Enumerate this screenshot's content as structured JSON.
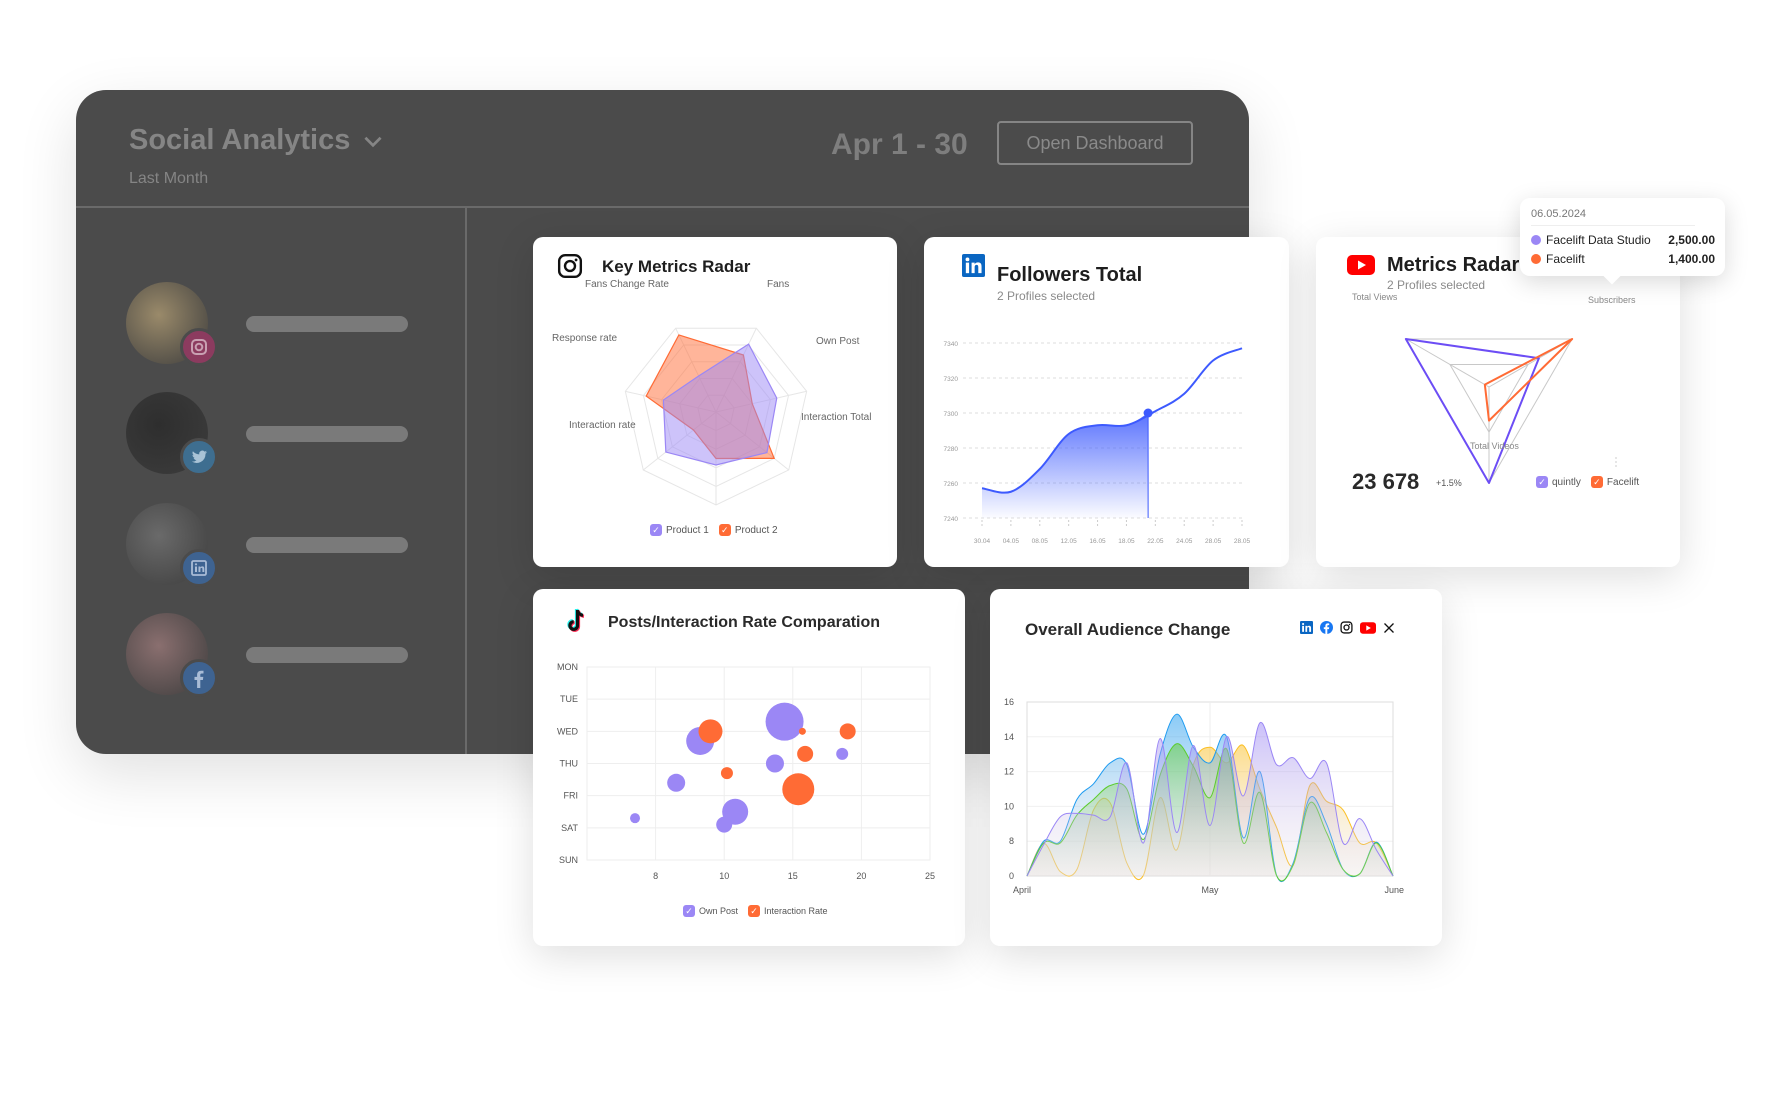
{
  "app": {
    "title": "Social Analytics",
    "subtitle": "Last Month",
    "date_range": "Apr 1 - 30",
    "open_button": "Open Dashboard"
  },
  "sidebar": {
    "profiles": [
      {
        "network": "instagram",
        "badge_icon": "instagram-icon",
        "badge_color": "#8c3b5f",
        "avatar_color": "#9a8a6a"
      },
      {
        "network": "twitter",
        "badge_icon": "twitter-icon",
        "badge_color": "#3e6e90",
        "avatar_color": "#2e2e2e"
      },
      {
        "network": "linkedin",
        "badge_icon": "linkedin-icon",
        "badge_color": "#3e6391",
        "avatar_color": "#6a6a6a"
      },
      {
        "network": "facebook",
        "badge_icon": "facebook-icon",
        "badge_color": "#3e6391",
        "avatar_color": "#8a6f6f"
      }
    ]
  },
  "cards": {
    "key_metrics": {
      "title": "Key Metrics Radar",
      "icon": "instagram-icon"
    },
    "followers": {
      "title": "Followers Total",
      "subtitle": "2 Profiles selected",
      "icon": "linkedin-icon"
    },
    "yt_radar": {
      "title": "Metrics Radar",
      "subtitle": "2 Profiles selected",
      "icon": "youtube-icon",
      "total": "23 678",
      "change": "+1.5%",
      "tooltip": {
        "date": "06.05.2024",
        "rows": [
          {
            "label": "Facelift Data Studio",
            "value": "2,500.00",
            "color": "#9b87f5"
          },
          {
            "label": "Facelift",
            "value": "1,400.00",
            "color": "#ff6b35"
          }
        ]
      }
    },
    "posts": {
      "title": "Posts/Interaction Rate Comparation",
      "icon": "tiktok-icon"
    },
    "audience": {
      "title": "Overall Audience Change",
      "network_icons": [
        "linkedin-icon",
        "facebook-icon",
        "instagram-icon",
        "youtube-icon",
        "x-icon"
      ]
    }
  },
  "colors": {
    "purple": "#9b87f5",
    "orange": "#ff6b35",
    "blue": "#3d5afe",
    "youtube": "#ff0000",
    "linkedin": "#0a66c2"
  },
  "chart_data": [
    {
      "type": "radar",
      "axes": [
        "Fans",
        "Own Post",
        "Interaction Total",
        "",
        "Interaction rate",
        "Response rate",
        "Fans Change Rate"
      ],
      "range": [
        0,
        100
      ],
      "series": [
        {
          "name": "Product 1",
          "color": "#9b87f5",
          "values": [
            81,
            67,
            70,
            57,
            69,
            58,
            43
          ]
        },
        {
          "name": "Product 2",
          "color": "#ff6b35",
          "values": [
            68,
            40,
            80,
            50,
            31,
            77,
            92
          ]
        }
      ],
      "legend": "bottom"
    },
    {
      "type": "area",
      "categories": [
        "30.04",
        "04.05",
        "08.05",
        "12.05",
        "16.05",
        "18.05",
        "22.05",
        "24.05",
        "28.05",
        "28.05"
      ],
      "values": [
        7257,
        7255,
        7268,
        7288,
        7293,
        7293,
        7301,
        7311,
        7330,
        7337
      ],
      "yticks": [
        7240,
        7260,
        7280,
        7300,
        7320,
        7340
      ],
      "ylim": [
        7240,
        7340
      ],
      "highlight_value": 7300,
      "color": "#3d5afe",
      "grid": true
    },
    {
      "type": "radar",
      "axes": [
        "Total Views",
        "Subscribers",
        "Total Videos"
      ],
      "range": [
        0,
        100
      ],
      "series": [
        {
          "name": "quintly",
          "color": "#6c4df5",
          "values": [
            100,
            60,
            100
          ]
        },
        {
          "name": "Facelift",
          "color": "#ff6b35",
          "values": [
            5,
            100,
            35
          ]
        }
      ],
      "legend": "bottom-right"
    },
    {
      "type": "scatter",
      "ycategories": [
        "MON",
        "TUE",
        "WED",
        "THU",
        "FRI",
        "SAT",
        "SUN"
      ],
      "xticks": [
        8,
        10,
        15,
        20,
        25
      ],
      "xlim": [
        5,
        25
      ],
      "series": [
        {
          "name": "Own Post",
          "color": "#9b87f5",
          "points": [
            {
              "x": 14.4,
              "y": 1.7,
              "z": 19
            },
            {
              "x": 9.3,
              "y": 2.3,
              "z": 14
            },
            {
              "x": 13.7,
              "y": 3.0,
              "z": 9
            },
            {
              "x": 18.6,
              "y": 2.7,
              "z": 6
            },
            {
              "x": 8.6,
              "y": 3.6,
              "z": 9
            },
            {
              "x": 10.8,
              "y": 4.5,
              "z": 13
            },
            {
              "x": 10.0,
              "y": 4.9,
              "z": 8
            },
            {
              "x": 7.1,
              "y": 4.7,
              "z": 5
            }
          ]
        },
        {
          "name": "Interaction Rate",
          "color": "#ff6b35",
          "points": [
            {
              "x": 9.6,
              "y": 2.0,
              "z": 12
            },
            {
              "x": 15.7,
              "y": 2.0,
              "z": 3.5
            },
            {
              "x": 19.0,
              "y": 2.0,
              "z": 8
            },
            {
              "x": 15.9,
              "y": 2.7,
              "z": 8
            },
            {
              "x": 10.2,
              "y": 3.3,
              "z": 6
            },
            {
              "x": 15.4,
              "y": 3.8,
              "z": 16
            }
          ]
        }
      ],
      "legend": "bottom",
      "grid": true
    },
    {
      "type": "area",
      "xticks": [
        "April",
        "May",
        "June"
      ],
      "yticks": [
        0,
        8,
        10,
        12,
        14,
        16
      ],
      "ylim": [
        0,
        16
      ],
      "series": [
        {
          "color": "#fbbf24",
          "values": [
            0,
            7.5,
            1,
            1.5,
            9.8,
            10.2,
            3,
            0.2,
            10.5,
            6,
            12.4,
            13.4,
            12.5,
            13.5,
            11,
            8.8,
            2.5,
            11.2,
            10.3,
            9.8,
            7.6,
            7.6,
            0
          ]
        },
        {
          "color": "#1e9bf0",
          "values": [
            0,
            8,
            8,
            10.4,
            11.3,
            12.5,
            12.4,
            8.4,
            13,
            15.3,
            13.4,
            12.5,
            14,
            8.2,
            12,
            0.2,
            3,
            10.5,
            9,
            1.5,
            0.5,
            7.8,
            0
          ]
        },
        {
          "color": "#5ccc2e",
          "values": [
            0,
            7.6,
            7.6,
            9.5,
            10.4,
            11.2,
            11,
            8.1,
            11.8,
            13.6,
            12.3,
            10.5,
            13.3,
            7.6,
            10.8,
            0.1,
            2.5,
            10.2,
            8.5,
            1.5,
            0.5,
            7.6,
            0
          ]
        },
        {
          "color": "#9b87f5",
          "values": [
            0,
            7.2,
            9.4,
            9.6,
            9.5,
            9.4,
            12.5,
            7.6,
            13.9,
            8.5,
            13.5,
            8.9,
            14,
            10.6,
            14.8,
            12.4,
            12.8,
            11.6,
            12.5,
            7.6,
            9.3,
            6,
            0
          ]
        }
      ],
      "grid": true
    }
  ]
}
